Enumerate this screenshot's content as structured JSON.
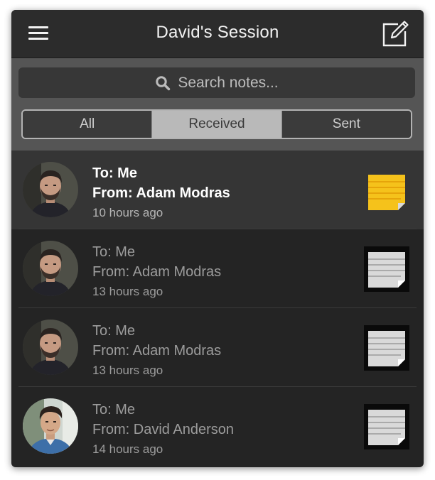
{
  "header": {
    "title": "David's Session"
  },
  "search": {
    "placeholder": "Search notes..."
  },
  "tabs": [
    {
      "label": "All",
      "active": false
    },
    {
      "label": "Received",
      "active": true
    },
    {
      "label": "Sent",
      "active": false
    }
  ],
  "notes": [
    {
      "to": "To: Me",
      "from": "From: Adam Modras",
      "time": "10 hours ago",
      "unread": true,
      "note_color": "#f5c21b",
      "note_icon": "yellow-note-icon",
      "avatar": "adam-avatar"
    },
    {
      "to": "To: Me",
      "from": "From: Adam Modras",
      "time": "13 hours ago",
      "unread": false,
      "note_color": "#d9d9d9",
      "note_icon": "gray-note-icon",
      "avatar": "adam-avatar"
    },
    {
      "to": "To: Me",
      "from": "From: Adam Modras",
      "time": "13 hours ago",
      "unread": false,
      "note_color": "#d9d9d9",
      "note_icon": "gray-note-icon",
      "avatar": "adam-avatar"
    },
    {
      "to": "To: Me",
      "from": "From: David Anderson",
      "time": "14 hours ago",
      "unread": false,
      "note_color": "#d9d9d9",
      "note_icon": "gray-note-icon",
      "avatar": "david-avatar"
    }
  ],
  "colors": {
    "background": "#242424",
    "header": "#2c2c2c",
    "toolbar": "#555555",
    "active_tab": "#b9b9b9"
  }
}
